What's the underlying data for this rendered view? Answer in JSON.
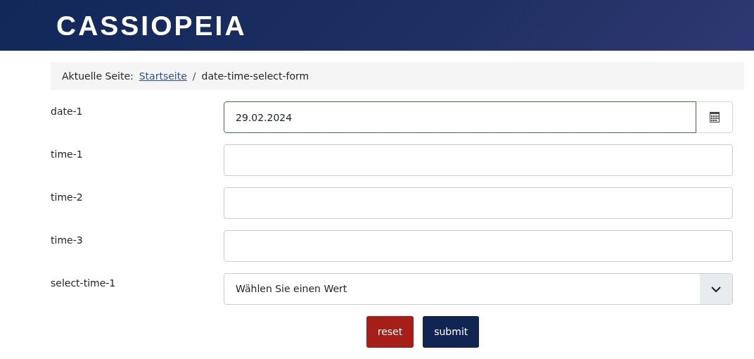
{
  "header": {
    "logo": "CASSIOPEIA"
  },
  "breadcrumb": {
    "prefix": "Aktuelle Seite:",
    "separator": "/",
    "items": [
      {
        "label": "Startseite",
        "link": true
      },
      {
        "label": "date-time-select-form",
        "link": false
      }
    ]
  },
  "fields": [
    {
      "label": "date-1",
      "kind": "date",
      "value": "29.02.2024",
      "valid": true
    },
    {
      "label": "time-1",
      "kind": "text",
      "valid": false
    },
    {
      "label": "time-2",
      "kind": "text",
      "valid": false
    },
    {
      "label": "time-3",
      "kind": "text",
      "valid": false
    },
    {
      "label": "select-time-1",
      "kind": "select",
      "value": "Wählen Sie einen Wert",
      "valid": false
    }
  ],
  "buttons": [
    {
      "label": "reset",
      "kind": "reset"
    },
    {
      "label": "submit",
      "kind": "submit"
    }
  ]
}
